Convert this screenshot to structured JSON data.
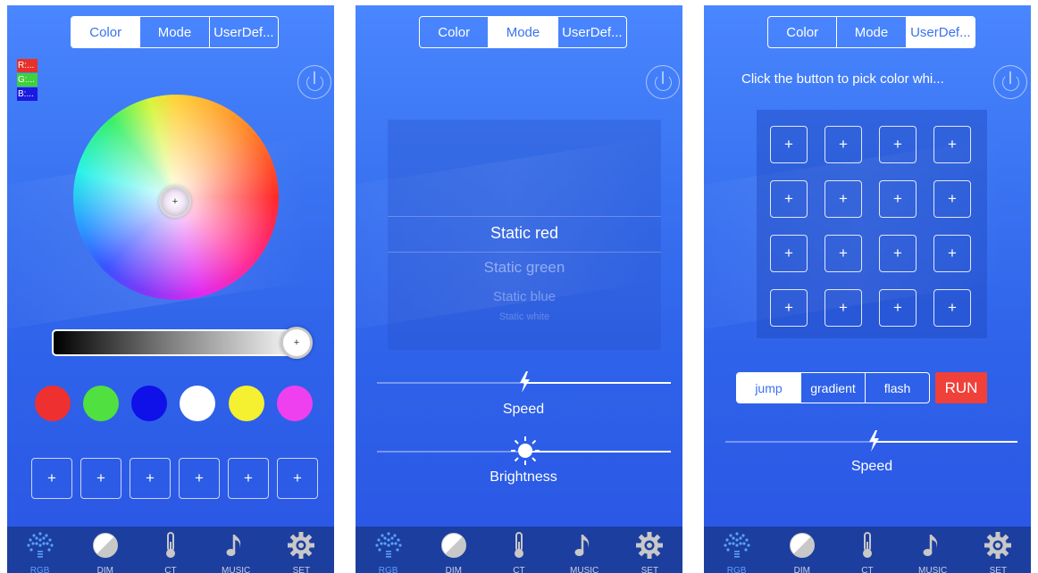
{
  "segments": [
    "Color",
    "Mode",
    "UserDef..."
  ],
  "panel1": {
    "rgb": {
      "r": "R:...",
      "g": "G:...",
      "b": "B:..."
    },
    "wheel_knob_symbol": "+",
    "brightness_knob_symbol": "+",
    "swatches": [
      "#ef3030",
      "#50e040",
      "#1010e8",
      "#ffffff",
      "#f5f030",
      "#ee40ee"
    ],
    "custom_slots": [
      "+",
      "+",
      "+",
      "+",
      "+",
      "+"
    ]
  },
  "panel2": {
    "modes": [
      "Static red",
      "Static green",
      "Static blue",
      "Static white"
    ],
    "speed_label": "Speed",
    "brightness_label": "Brightness"
  },
  "panel3": {
    "instruction": "Click the button to pick color whi...",
    "grid_buttons": [
      "+",
      "+",
      "+",
      "+",
      "+",
      "+",
      "+",
      "+",
      "+",
      "+",
      "+",
      "+",
      "+",
      "+",
      "+",
      "+"
    ],
    "effects": [
      "jump",
      "gradient",
      "flash"
    ],
    "run_label": "RUN",
    "speed_label": "Speed"
  },
  "tabs": [
    {
      "label": "RGB",
      "icon": "rgb-dots-icon"
    },
    {
      "label": "DIM",
      "icon": "dim-half-circle-icon"
    },
    {
      "label": "CT",
      "icon": "thermometer-icon"
    },
    {
      "label": "MUSIC",
      "icon": "music-note-icon"
    },
    {
      "label": "SET",
      "icon": "gear-icon"
    }
  ],
  "colors": {
    "accent": "#3a72f0",
    "run": "#f0403a",
    "tabbar": "#1c3e9e"
  }
}
